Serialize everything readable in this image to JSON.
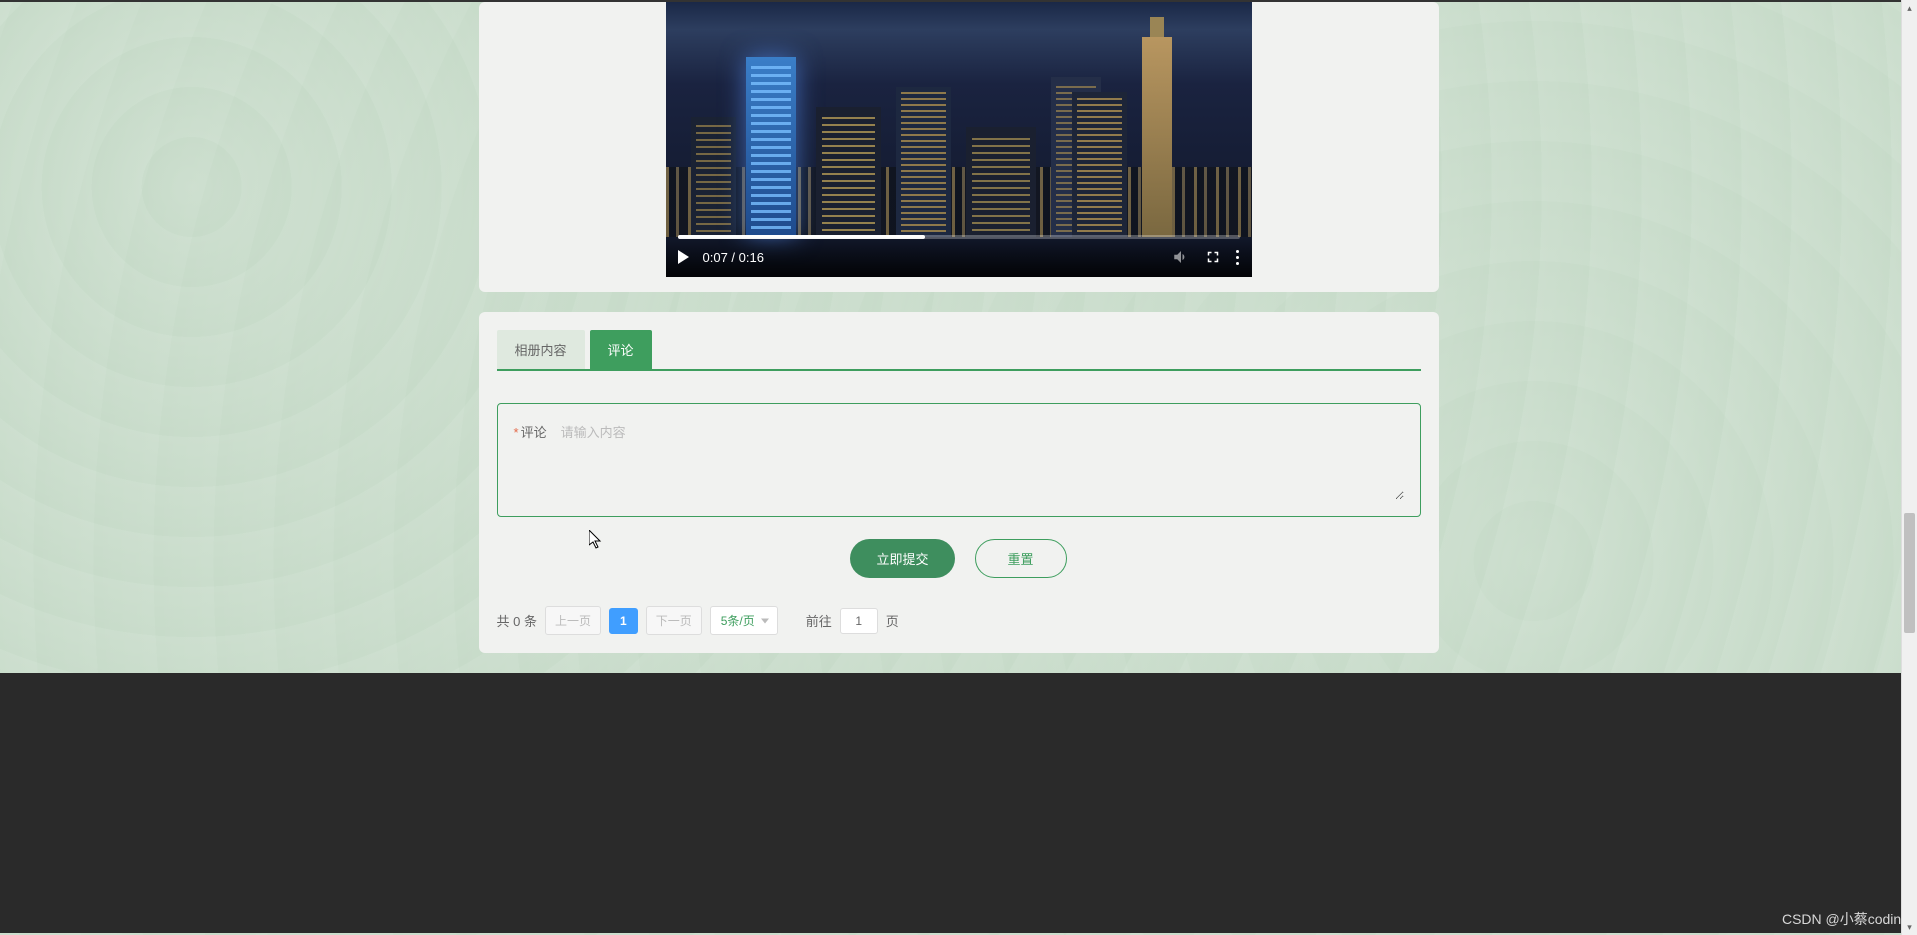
{
  "video": {
    "time_current": "0:07",
    "time_separator": " / ",
    "time_total": "0:16",
    "icons": {
      "play": "play-icon",
      "volume": "volume-icon",
      "fullscreen": "fullscreen-icon",
      "menu": "menu-icon"
    }
  },
  "tabs": {
    "album": "相册内容",
    "comment": "评论",
    "active": "comment"
  },
  "commentForm": {
    "required_mark": "*",
    "label": "评论",
    "placeholder": "请输入内容",
    "value": "",
    "submit": "立即提交",
    "reset": "重置"
  },
  "pagination": {
    "total_prefix": "共 ",
    "total_count": "0",
    "total_suffix": " 条",
    "prev": "上一页",
    "current_page": "1",
    "next": "下一页",
    "page_size": "5条/页",
    "jump_prefix": "前往",
    "jump_value": "1",
    "jump_suffix": "页"
  },
  "watermark": "CSDN @小蔡coding"
}
